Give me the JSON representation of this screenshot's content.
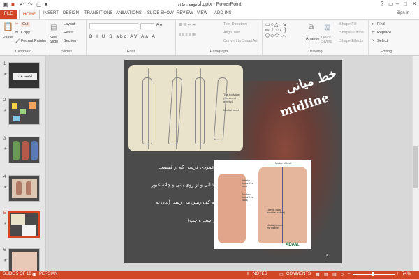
{
  "title_bar": {
    "window_title": "آناتومی بدن.pptx - PowerPoint",
    "quick_access": [
      "save-icon",
      "undo-icon",
      "redo-icon",
      "start-icon"
    ],
    "controls": [
      "?",
      "▭",
      "–",
      "□",
      "✕"
    ]
  },
  "tabs": [
    "FILE",
    "HOME",
    "INSERT",
    "DESIGN",
    "TRANSITIONS",
    "ANIMATIONS",
    "SLIDE SHOW",
    "REVIEW",
    "VIEW",
    "ADD-INS"
  ],
  "signin": "Sign in",
  "ribbon": {
    "clipboard": {
      "paste": "Paste",
      "cut": "Cut",
      "copy": "Copy",
      "format_painter": "Format Painter",
      "label": "Clipboard"
    },
    "slides": {
      "new_slide": "New Slide",
      "layout": "Layout",
      "reset": "Reset",
      "section": "Section",
      "label": "Slides"
    },
    "font": {
      "label": "Font",
      "buttons": "B I U S abc AV Aa A"
    },
    "paragraph": {
      "text_direction": "Text Direction",
      "align_text": "Align Text",
      "convert": "Convert to SmartArt",
      "label": "Paragraph"
    },
    "drawing": {
      "arrange": "Arrange",
      "quick_styles": "Quick Styles",
      "shape_fill": "Shape Fill",
      "shape_outline": "Shape Outline",
      "shape_effects": "Shape Effects",
      "label": "Drawing"
    },
    "editing": {
      "find": "Find",
      "replace": "Replace",
      "select": "Select",
      "label": "Editing"
    }
  },
  "thumbnails": [
    {
      "num": "1",
      "text": "آناتومی بدن"
    },
    {
      "num": "2",
      "text": ""
    },
    {
      "num": "3",
      "text": ""
    },
    {
      "num": "4",
      "text": ""
    },
    {
      "num": "5",
      "text": ""
    },
    {
      "num": "6",
      "text": ""
    }
  ],
  "slide": {
    "title_fa": "خط میانی",
    "title_en": "midline",
    "body_lines": [
      "یک خط عمودی فرضی که از قسمت",
      "میانی پیشانی و از روی بینی و چانه عبور",
      "کرده و به کف زمین   می رسد. (بدن به",
      "دو نیمه راست و چپ)"
    ],
    "sketch_labels": [
      "The bodyline (Centre of gravity)",
      "Medial head"
    ],
    "anat_labels": [
      "Midline of body",
      "Anterior (toward the front)",
      "Posterior (toward the back)",
      "Lateral (away from the midline)",
      "Medial (toward the midline)"
    ],
    "adam": "ADAM.",
    "page_number": "5"
  },
  "status": {
    "slide_info": "SLIDE 5 OF 10",
    "language": "PERSIAN",
    "notes": "NOTES",
    "comments": "COMMENTS",
    "zoom": "74%"
  }
}
